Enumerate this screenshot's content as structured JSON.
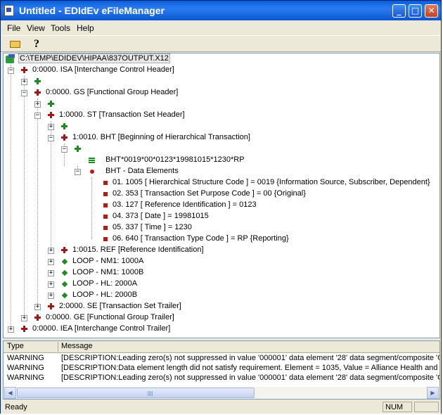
{
  "window": {
    "title": "Untitled - EDIdEv eFileManager"
  },
  "menubar": {
    "items": [
      "File",
      "View",
      "Tools",
      "Help"
    ]
  },
  "tree": {
    "root_path": "C:\\TEMP\\EDIDEV\\HIPAA\\837OUTPUT.X12",
    "nodes": [
      {
        "text": "0:0000. ISA [Interchange Control Header]"
      },
      {
        "text": "0:0000. GS [Functional Group Header]"
      },
      {
        "text": "1:0000. ST [Transaction Set Header]"
      },
      {
        "text": "1:0010. BHT [Beginning of Hierarchical Transaction]"
      },
      {
        "text": "BHT*0019*00*0123*19981015*1230*RP"
      },
      {
        "text": "BHT - Data Elements"
      },
      {
        "text": "01.  1005 [ Hierarchical Structure Code ] = 0019 {Information Source,  Subscriber,  Dependent}"
      },
      {
        "text": "02.  353  [ Transaction Set Purpose Code ] = 00 {Original}"
      },
      {
        "text": "03.  127  [ Reference Identification ] = 0123"
      },
      {
        "text": "04.  373  [ Date ] = 19981015"
      },
      {
        "text": "05.  337  [ Time ] = 1230"
      },
      {
        "text": "06.  640  [ Transaction Type Code ] = RP {Reporting}"
      },
      {
        "text": "1:0015. REF [Reference Identification]"
      },
      {
        "text": "LOOP - NM1: 1000A"
      },
      {
        "text": "LOOP - NM1: 1000B"
      },
      {
        "text": "LOOP - HL: 2000A"
      },
      {
        "text": "LOOP - HL: 2000B"
      },
      {
        "text": "2:0000. SE [Transaction Set Trailer]"
      },
      {
        "text": "0:0000. GE [Functional Group Trailer]"
      },
      {
        "text": "0:0000. IEA [Interchange Control Trailer]"
      }
    ]
  },
  "log": {
    "columns": [
      "Type",
      "Message"
    ],
    "rows": [
      {
        "type": "WARNING",
        "message": "[DESCRIPTION:Leading zero(s) not suppressed in value '000001' data element '28' data segment/composite 'GS'"
      },
      {
        "type": "WARNING",
        "message": "[DESCRIPTION:Data element length did not satisfy requirement. Element = 1035, Value = Alliance Health and Lif"
      },
      {
        "type": "WARNING",
        "message": "[DESCRIPTION:Leading zero(s) not suppressed in value '000001' data element '28' data segment/composite 'GE'"
      }
    ]
  },
  "status": {
    "text": "Ready",
    "num": "NUM"
  }
}
